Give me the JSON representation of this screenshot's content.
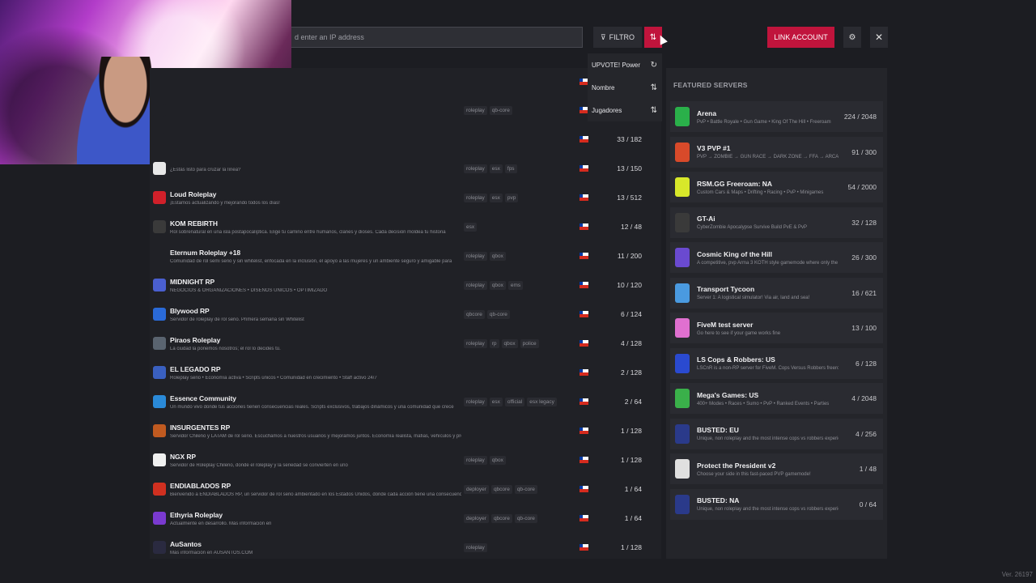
{
  "search": {
    "placeholder": "d enter an IP address"
  },
  "toolbar": {
    "filter_label": "FILTRO",
    "filter_icon": "filter-icon",
    "sort_icon": "sort-icon",
    "link_account_label": "LINK ACCOUNT",
    "settings_icon": "gear-icon",
    "close_icon": "close-icon",
    "accent": "#c0143c"
  },
  "sort_menu": [
    {
      "label": "UPVOTE! Power",
      "icon": "↻"
    },
    {
      "label": "Nombre",
      "icon": "⇅"
    },
    {
      "label": "Jugadores",
      "icon": "⇅"
    }
  ],
  "servers": [
    {
      "name": "",
      "desc": "",
      "tags": [
        "roleplay",
        "qb-core"
      ],
      "players": "",
      "logo": "#202126"
    },
    {
      "name": "",
      "desc": "",
      "tags": [],
      "players": "33 / 182",
      "logo": "#202126"
    },
    {
      "name": "",
      "desc": "¿Estás listo para cruzar la línea?",
      "tags": [
        "roleplay",
        "esx",
        "fps"
      ],
      "players": "13 / 150",
      "logo": "#e8e8e8"
    },
    {
      "name": "Loud Roleplay",
      "desc": "¡Estamos actualizando y mejorando todos los días!",
      "tags": [
        "roleplay",
        "esx",
        "pvp"
      ],
      "players": "13 / 512",
      "logo": "#d0202a"
    },
    {
      "name": "KOM REBIRTH",
      "desc": "Rol sobrenatural en una isla postapocalíptica. Elige tu camino entre humanos, clanes y dioses. Cada decisión moldea tu historia",
      "tags": [
        "esx"
      ],
      "players": "12 / 48",
      "logo": "#3a3a3a"
    },
    {
      "name": "Eternum Roleplay +18",
      "desc": "Comunidad de rol semi serio y sin whitelist, enfocada en la inclusión, el apoyo a las mujeres y un ambiente seguro y amigable para",
      "tags": [
        "roleplay",
        "qbox"
      ],
      "players": "11 / 200",
      "logo": "#202126"
    },
    {
      "name": "MIDNIGHT RP",
      "desc": "NEGOCIOS & ORGANIZACIONES • DISEÑOS UNICOS • OPTIMIZADO",
      "tags": [
        "roleplay",
        "qbox",
        "ems"
      ],
      "players": "10 / 120",
      "logo": "#4a5fd0"
    },
    {
      "name": "Blywood RP",
      "desc": "Servidor de roleplay de rol serio. Primera semana sin Whitelist",
      "tags": [
        "qbcore",
        "qb-core"
      ],
      "players": "6 / 124",
      "logo": "#2a6ad8"
    },
    {
      "name": "Piraos Roleplay",
      "desc": "La ciudad la ponemos nosotros; el rol lo decides tú.",
      "tags": [
        "roleplay",
        "rp",
        "qbox",
        "police"
      ],
      "players": "4 / 128",
      "logo": "#5a6470"
    },
    {
      "name": "EL LEGADO RP",
      "desc": "Roleplay serio • Economía activa • Scripts únicos • Comunidad en crecimiento • Staff activo 24/7",
      "tags": [],
      "players": "2 / 128",
      "logo": "#3a60c0"
    },
    {
      "name": "Essence Community",
      "desc": "Un mundo vivo donde tus acciones tienen consecuencias reales. Scripts exclusivos, trabajos dinámicos y una comunidad que crece",
      "tags": [
        "roleplay",
        "esx",
        "official",
        "esx legacy"
      ],
      "players": "2 / 64",
      "logo": "#2a8ad8"
    },
    {
      "name": "INSURGENTES RP",
      "desc": "Servidor Chileno y LATAM de rol serio. Escuchamos a nuestros usuarios y mejoramos juntos. Economía realista, mafias, vehículos y propiedades.",
      "tags": [],
      "players": "1 / 128",
      "logo": "#c05a20"
    },
    {
      "name": "NGX RP",
      "desc": "Servidor de Roleplay Chileno, donde el roleplay y la seriedad se convierten en uno",
      "tags": [
        "roleplay",
        "qbox"
      ],
      "players": "1 / 128",
      "logo": "#f0f0f0"
    },
    {
      "name": "ENDIABLADOS RP",
      "desc": "Bienvenido a ENDIABLADOS RP, un servidor de rol serio ambientado en los Estados Unidos, donde cada acción tiene una consecuencia",
      "tags": [
        "deployer",
        "qbcore",
        "qb-core"
      ],
      "players": "1 / 64",
      "logo": "#d03020"
    },
    {
      "name": "Ethyria Roleplay",
      "desc": "Actualmente en desarrollo. Más información en",
      "tags": [
        "deployer",
        "qbcore",
        "qb-core"
      ],
      "players": "1 / 64",
      "logo": "#7a3ad0"
    },
    {
      "name": "AuSantos",
      "desc": "Más información en AUSANTOS.COM",
      "tags": [
        "roleplay"
      ],
      "players": "1 / 128",
      "logo": "#2a2a40"
    }
  ],
  "featured": {
    "title": "FEATURED SERVERS",
    "items": [
      {
        "name": "Arena",
        "desc": "PvP • Battle Royale • Gun Game • King Of The Hill • Freeroam",
        "players": "224 / 2048",
        "logo": "#2ab04a"
      },
      {
        "name": "V3 PVP #1",
        "desc": "PVP → ZOMBIE → GUN RACE → DARK ZONE → FFA → ARCADE",
        "players": "91 / 300",
        "logo": "#d84a2a"
      },
      {
        "name": "RSM.GG Freeroam: NA",
        "desc": "Custom Cars & Maps • Drifting • Racing • PvP • Minigames",
        "players": "54 / 2000",
        "logo": "#d8e82a"
      },
      {
        "name": "GT-Ai",
        "desc": "CyberZombie Apocalypse Survive Build PvE & PvP",
        "players": "32 / 128",
        "logo": "#3a3a3a"
      },
      {
        "name": "Cosmic King of the Hill",
        "desc": "A competitive, pvp Arma 3 KOTH style gamemode where only the",
        "players": "26 / 300",
        "logo": "#6a4ad0"
      },
      {
        "name": "Transport Tycoon",
        "desc": "Server 1: A logistical simulator! Via air, land and sea!",
        "players": "16 / 621",
        "logo": "#4a9ae0"
      },
      {
        "name": "FiveM test server",
        "desc": "Go here to see if your game works fine",
        "players": "13 / 100",
        "logo": "#e070d0"
      },
      {
        "name": "LS Cops & Robbers: US",
        "desc": "LSCnR is a non-RP server for FiveM. Cops Versus Robbers freeroam",
        "players": "6 / 128",
        "logo": "#2a4ad0"
      },
      {
        "name": "Mega's Games: US",
        "desc": "400+ Modes • Races • Sumo • PvP • Ranked Events • Parties",
        "players": "4 / 2048",
        "logo": "#3ab04a"
      },
      {
        "name": "BUSTED: EU",
        "desc": "Unique, non roleplay and the most intense cops vs robbers experience",
        "players": "4 / 256",
        "logo": "#2a3a8a"
      },
      {
        "name": "Protect the President v2",
        "desc": "Choose your side in this fast-paced PVP gamemode!",
        "players": "1 / 48",
        "logo": "#e0e0e0"
      },
      {
        "name": "BUSTED: NA",
        "desc": "Unique, non roleplay and the most intense cops vs robbers experience",
        "players": "0 / 64",
        "logo": "#2a3a8a"
      }
    ]
  },
  "version": "Ver. 26197"
}
